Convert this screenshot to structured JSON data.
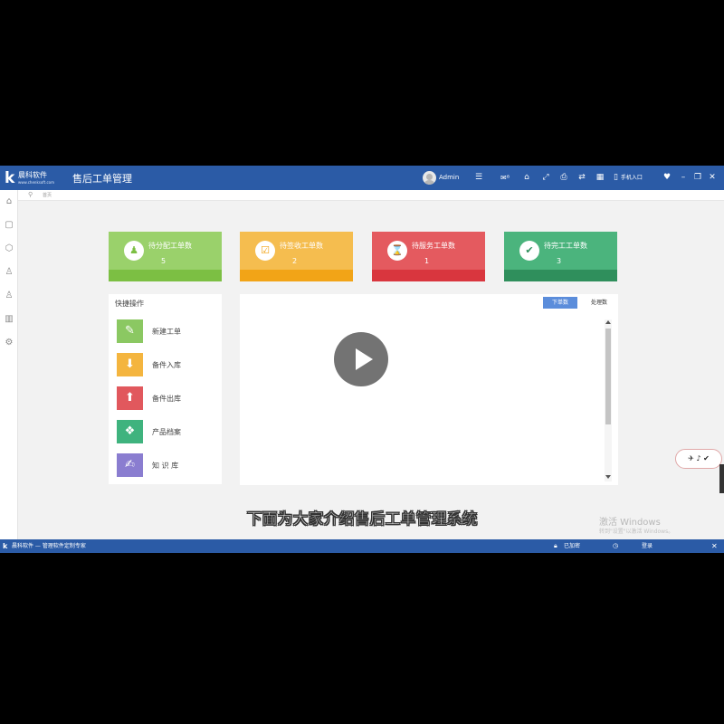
{
  "window": {
    "logo_glyph": "k",
    "logo_name": "晨科软件",
    "logo_url": "www.chenksoft.com",
    "title": "售后工单管理",
    "username": "Admin",
    "mobile_entry": "手机入口"
  },
  "toolbar_icons": [
    "menu-icon",
    "message-icon",
    "home-icon",
    "fullscreen-icon",
    "print-icon",
    "refresh-icon",
    "calculator-icon",
    "mobile-icon",
    "skin-icon",
    "minimize-icon",
    "restore-icon",
    "close-icon"
  ],
  "sidebar": {
    "items": [
      {
        "icon": "home-icon",
        "glyph": "⌂"
      },
      {
        "icon": "order-icon",
        "glyph": "▢"
      },
      {
        "icon": "box-icon",
        "glyph": "⬡"
      },
      {
        "icon": "customer-icon",
        "glyph": "♙"
      },
      {
        "icon": "staff-icon",
        "glyph": "♙"
      },
      {
        "icon": "report-icon",
        "glyph": "▥"
      },
      {
        "icon": "settings-icon",
        "glyph": "⚙"
      }
    ]
  },
  "breadcrumb": {
    "label": "首页"
  },
  "stats": [
    {
      "label": "待分配工单数",
      "value": "5",
      "color": "#9ad16b",
      "band": "#7cbf43",
      "icon": "people-icon",
      "glyph": "♟"
    },
    {
      "label": "待签收工单数",
      "value": "2",
      "color": "#f5bd4f",
      "band": "#f2a417",
      "icon": "clipboard-icon",
      "glyph": "☑"
    },
    {
      "label": "待服务工单数",
      "value": "1",
      "color": "#e45a5f",
      "band": "#d9363e",
      "icon": "hourglass-icon",
      "glyph": "⌛"
    },
    {
      "label": "待完工工单数",
      "value": "3",
      "color": "#4bb47d",
      "band": "#2f8f5c",
      "icon": "document-check-icon",
      "glyph": "✔"
    }
  ],
  "quick_ops": {
    "title": "快捷操作",
    "items": [
      {
        "label": "新建工单",
        "color": "#8bc862",
        "icon": "edit-icon",
        "glyph": "✎"
      },
      {
        "label": "备件入库",
        "color": "#f4b53f",
        "icon": "inbox-in-icon",
        "glyph": "⬇"
      },
      {
        "label": "备件出库",
        "color": "#e1585d",
        "icon": "inbox-out-icon",
        "glyph": "⬆"
      },
      {
        "label": "产品档案",
        "color": "#3fb37e",
        "icon": "grid-icon",
        "glyph": "❖"
      },
      {
        "label": "知 识 库",
        "color": "#8a7dd0",
        "icon": "book-icon",
        "glyph": "✍"
      }
    ]
  },
  "panel": {
    "tabs": [
      {
        "label": "下单数",
        "active": true
      },
      {
        "label": "处理数",
        "active": false
      }
    ]
  },
  "floating_widget": {
    "text": "✈ ♪ ✔"
  },
  "subtitle": "下面为大家介绍售后工单管理系统",
  "watermark": {
    "line1": "激活 Windows",
    "line2": "转到\"设置\"以激活 Windows。"
  },
  "statusbar": {
    "text": "晨科软件 — 管理软件定制专家",
    "encryption": "已加密",
    "login": "登录"
  },
  "colors": {
    "titlebar": "#2b5ba6",
    "tab_active": "#5b8ddb"
  }
}
